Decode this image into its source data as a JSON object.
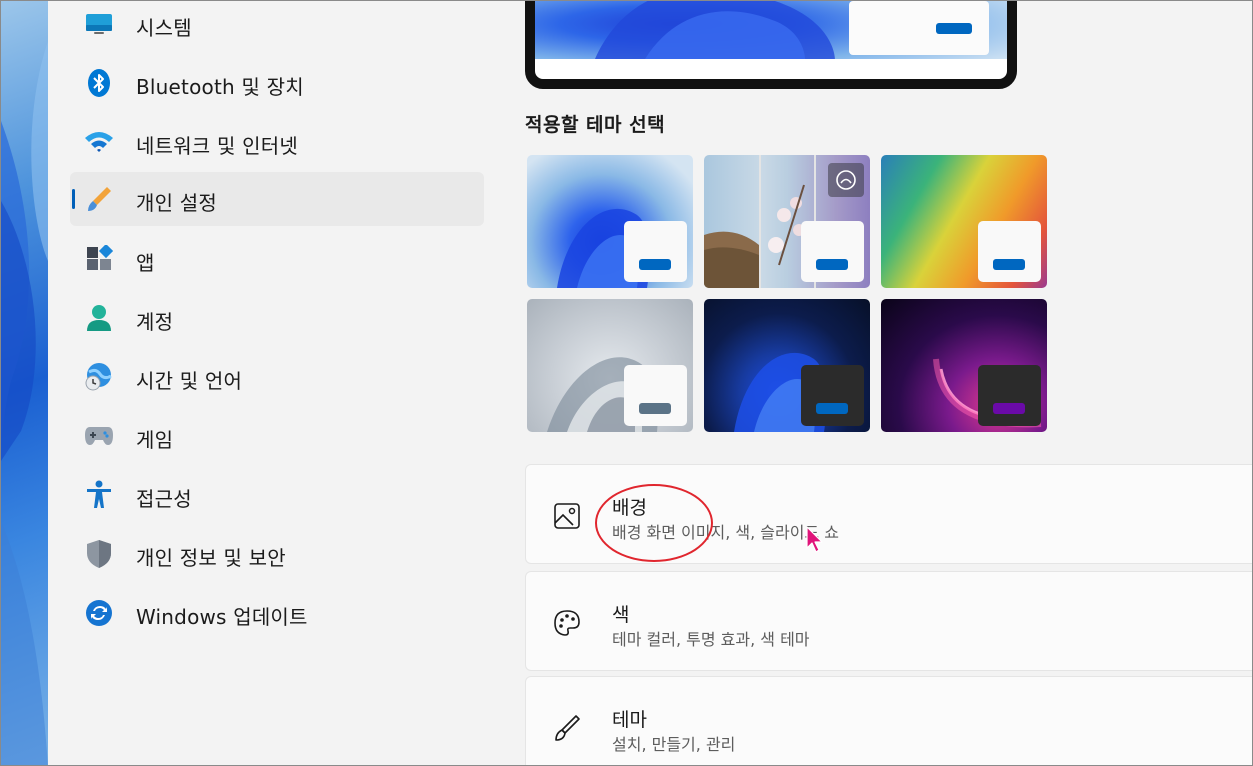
{
  "sidebar": {
    "items": [
      {
        "label": "시스템",
        "icon": "monitor-icon",
        "active": false
      },
      {
        "label": "Bluetooth 및 장치",
        "icon": "bluetooth-icon",
        "active": false
      },
      {
        "label": "네트워크 및 인터넷",
        "icon": "wifi-icon",
        "active": false
      },
      {
        "label": "개인 설정",
        "icon": "paintbrush-icon",
        "active": true
      },
      {
        "label": "앱",
        "icon": "apps-icon",
        "active": false
      },
      {
        "label": "계정",
        "icon": "person-icon",
        "active": false
      },
      {
        "label": "시간 및 언어",
        "icon": "globe-clock-icon",
        "active": false
      },
      {
        "label": "게임",
        "icon": "gamepad-icon",
        "active": false
      },
      {
        "label": "접근성",
        "icon": "accessibility-icon",
        "active": false
      },
      {
        "label": "개인 정보 및 보안",
        "icon": "shield-icon",
        "active": false
      },
      {
        "label": "Windows 업데이트",
        "icon": "update-icon",
        "active": false
      }
    ]
  },
  "main": {
    "themes_title": "적용할 테마 선택",
    "themes": [
      {
        "name": "windows-light",
        "card_color": "#f9f9f9",
        "bar_color": "#0067c0"
      },
      {
        "name": "windows-spotlight",
        "card_color": "#f9f9f9",
        "bar_color": "#0067c0",
        "badge": "spotlight-icon"
      },
      {
        "name": "glow",
        "card_color": "#f9f9f9",
        "bar_color": "#0067c0"
      },
      {
        "name": "captured-motion",
        "card_color": "#f9f9f9",
        "bar_color": "#5b7387"
      },
      {
        "name": "windows-dark",
        "card_color": "#2b2b2b",
        "bar_color": "#0067c0"
      },
      {
        "name": "flow",
        "card_color": "#2b2b2b",
        "bar_color": "#6a0aa8"
      }
    ],
    "cards": [
      {
        "title": "배경",
        "subtitle": "배경 화면 이미지, 색, 슬라이드 쇼",
        "icon": "image-icon"
      },
      {
        "title": "색",
        "subtitle": "테마 컬러, 투명 효과, 색 테마",
        "icon": "palette-icon"
      },
      {
        "title": "테마",
        "subtitle": "설치, 만들기, 관리",
        "icon": "brush-icon"
      }
    ]
  },
  "colors": {
    "accent": "#005fb8",
    "annotation": "#e0262e",
    "cursor": "#e0147a"
  }
}
